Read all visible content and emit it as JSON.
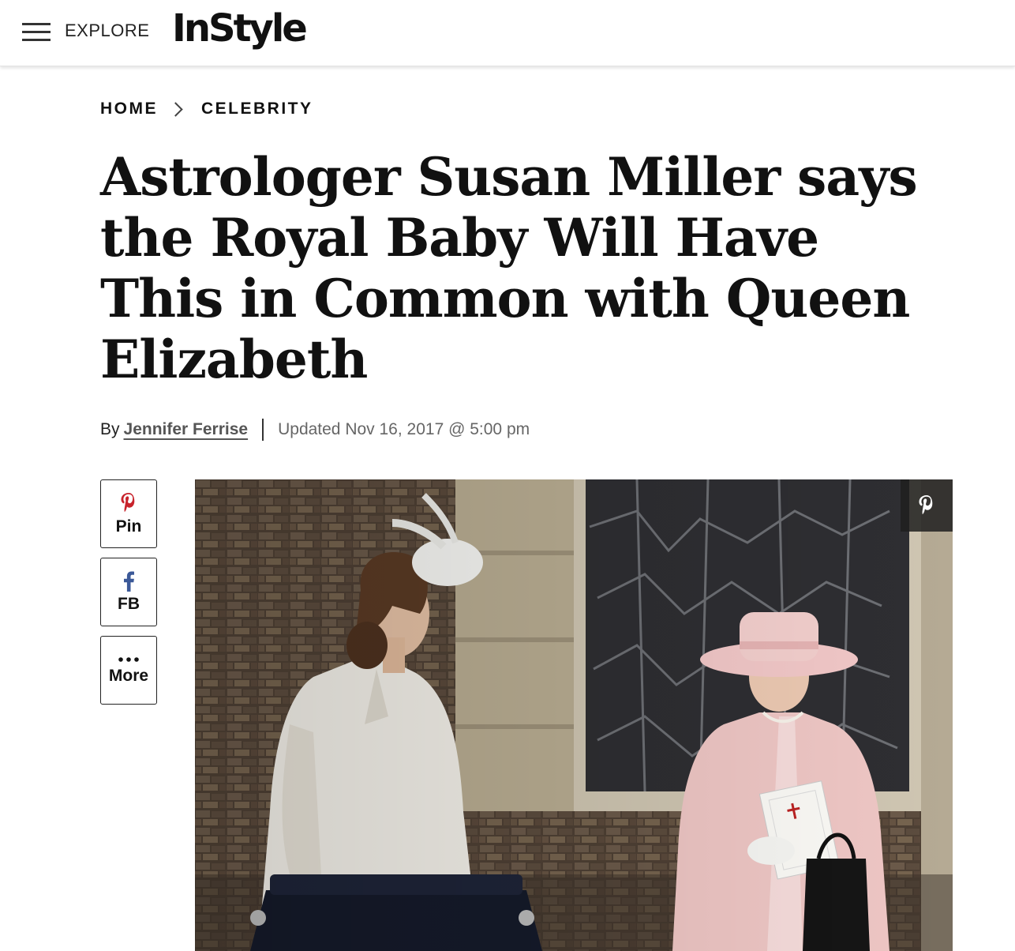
{
  "header": {
    "menu_icon": "hamburger-menu-icon",
    "explore_label": "EXPLORE",
    "logo_text": "InStyle"
  },
  "breadcrumb": {
    "items": [
      {
        "label": "HOME"
      },
      {
        "label": "CELEBRITY"
      }
    ],
    "separator_icon": "chevron-right-icon"
  },
  "article": {
    "headline": "Astrologer Susan Miller says the Royal Baby Will Have This in Common with Queen Elizabeth",
    "byline_prefix": "By",
    "author": "Jennifer Ferrise",
    "updated": "Updated Nov 16, 2017 @ 5:00 pm"
  },
  "share": {
    "buttons": [
      {
        "label": "Pin",
        "icon": "pinterest-icon",
        "color": "#c8232c"
      },
      {
        "label": "FB",
        "icon": "facebook-icon",
        "color": "#3b5998"
      },
      {
        "label": "More",
        "icon": "more-dots-icon",
        "color": "#111111"
      }
    ]
  },
  "hero": {
    "pin_icon": "pinterest-icon"
  },
  "colors": {
    "text": "#111111",
    "muted": "#666666",
    "pinterest": "#c8232c",
    "facebook": "#3b5998"
  }
}
